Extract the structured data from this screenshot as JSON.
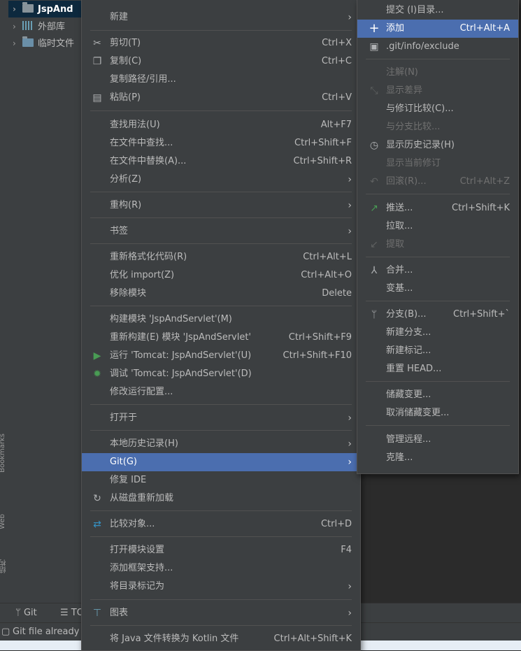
{
  "project_panel": {
    "root": "JspAnd",
    "items": [
      "外部库",
      "临时文件"
    ]
  },
  "left_strip": {
    "labels": [
      "Bookmarks",
      "Web",
      "结构"
    ]
  },
  "tool_window_bar": {
    "tabs": [
      "Git",
      "TO"
    ]
  },
  "status_bar": {
    "message": "Git file already"
  },
  "context_menu": {
    "items": [
      {
        "label": "新建",
        "submenu": true
      },
      {
        "label": "剪切(T)",
        "shortcut": "Ctrl+X",
        "icon": "scissors-icon"
      },
      {
        "label": "复制(C)",
        "shortcut": "Ctrl+C",
        "icon": "copy-icon"
      },
      {
        "label": "复制路径/引用..."
      },
      {
        "label": "粘贴(P)",
        "shortcut": "Ctrl+V",
        "icon": "paste-icon"
      },
      {
        "label": "查找用法(U)",
        "shortcut": "Alt+F7"
      },
      {
        "label": "在文件中查找...",
        "shortcut": "Ctrl+Shift+F"
      },
      {
        "label": "在文件中替换(A)...",
        "shortcut": "Ctrl+Shift+R"
      },
      {
        "label": "分析(Z)",
        "submenu": true
      },
      {
        "label": "重构(R)",
        "submenu": true
      },
      {
        "label": "书签",
        "submenu": true
      },
      {
        "label": "重新格式化代码(R)",
        "shortcut": "Ctrl+Alt+L"
      },
      {
        "label": "优化 import(Z)",
        "shortcut": "Ctrl+Alt+O"
      },
      {
        "label": "移除模块",
        "shortcut": "Delete"
      },
      {
        "label": "构建模块 'JspAndServlet'(M)"
      },
      {
        "label": "重新构建(E) 模块 'JspAndServlet'",
        "shortcut": "Ctrl+Shift+F9"
      },
      {
        "label": "运行 'Tomcat: JspAndServlet'(U)",
        "shortcut": "Ctrl+Shift+F10",
        "icon": "run-icon"
      },
      {
        "label": "调试 'Tomcat: JspAndServlet'(D)",
        "icon": "debug-icon"
      },
      {
        "label": "修改运行配置..."
      },
      {
        "label": "打开于",
        "submenu": true
      },
      {
        "label": "本地历史记录(H)",
        "submenu": true
      },
      {
        "label": "Git(G)",
        "submenu": true,
        "selected": true
      },
      {
        "label": "修复 IDE"
      },
      {
        "label": "从磁盘重新加载",
        "icon": "reload-icon"
      },
      {
        "label": "比较对象...",
        "shortcut": "Ctrl+D",
        "icon": "compare-icon"
      },
      {
        "label": "打开模块设置",
        "shortcut": "F4"
      },
      {
        "label": "添加框架支持..."
      },
      {
        "label": "将目录标记为",
        "submenu": true
      },
      {
        "label": "图表",
        "submenu": true,
        "icon": "diagram-icon"
      },
      {
        "label": "将 Java 文件转换为 Kotlin 文件",
        "shortcut": "Ctrl+Alt+Shift+K"
      }
    ]
  },
  "git_menu": {
    "items": [
      {
        "label": "提交 (I)目录..."
      },
      {
        "label": "添加",
        "shortcut": "Ctrl+Alt+A",
        "icon": "plus-icon",
        "selected": true
      },
      {
        "label": ".git/info/exclude",
        "icon": "git-file-icon"
      },
      {
        "label": "注解(N)",
        "disabled": true
      },
      {
        "label": "显示差异",
        "disabled": true,
        "icon": "diff-icon"
      },
      {
        "label": "与修订比较(C)..."
      },
      {
        "label": "与分支比较...",
        "disabled": true
      },
      {
        "label": "显示历史记录(H)",
        "icon": "history-icon"
      },
      {
        "label": "显示当前修订",
        "disabled": true
      },
      {
        "label": "回滚(R)...",
        "shortcut": "Ctrl+Alt+Z",
        "disabled": true,
        "icon": "rollback-icon"
      },
      {
        "label": "推送...",
        "shortcut": "Ctrl+Shift+K",
        "icon": "push-icon"
      },
      {
        "label": "拉取..."
      },
      {
        "label": "提取",
        "disabled": true,
        "icon": "fetch-icon"
      },
      {
        "label": "合并...",
        "icon": "merge-icon"
      },
      {
        "label": "变基..."
      },
      {
        "label": "分支(B)...",
        "shortcut": "Ctrl+Shift+`",
        "icon": "branch-icon"
      },
      {
        "label": "新建分支..."
      },
      {
        "label": "新建标记..."
      },
      {
        "label": "重置 HEAD..."
      },
      {
        "label": "储藏变更..."
      },
      {
        "label": "取消储藏变更..."
      },
      {
        "label": "管理远程..."
      },
      {
        "label": "克隆..."
      }
    ]
  },
  "colors": {
    "menu_bg": "#3c3f41",
    "selection": "#4b6eaf",
    "separator": "#515151",
    "run_green": "#499c54"
  }
}
